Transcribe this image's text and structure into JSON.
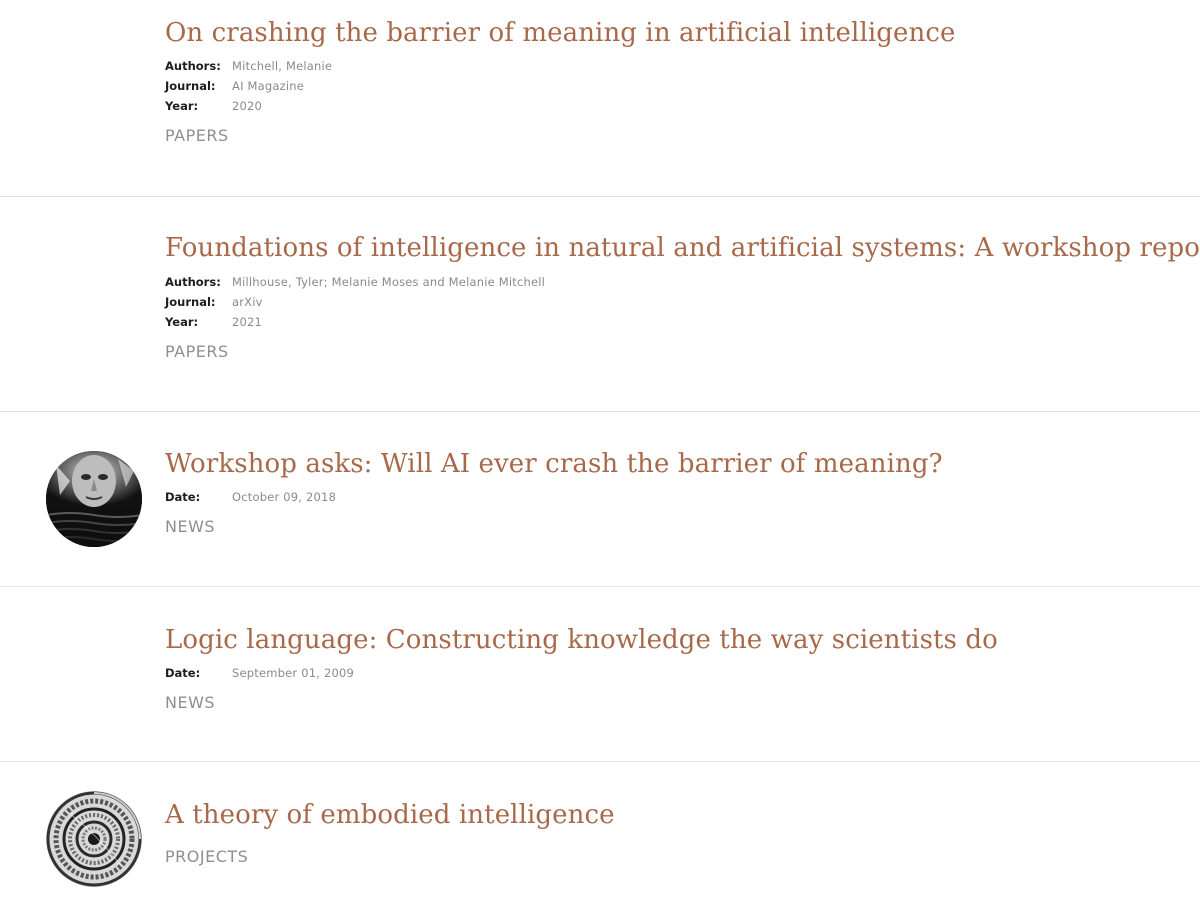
{
  "items": [
    {
      "title": "On crashing the barrier of meaning in artificial intelligence",
      "meta": [
        {
          "key": "Authors:",
          "value": "Mitchell, Melanie"
        },
        {
          "key": "Journal:",
          "value": "AI Magazine"
        },
        {
          "key": "Year:",
          "value": "2020"
        }
      ],
      "category": "PAPERS"
    },
    {
      "title": "Foundations of intelligence in natural and artificial systems: A workshop report",
      "meta": [
        {
          "key": "Authors:",
          "value": "Millhouse, Tyler; Melanie Moses and Melanie Mitchell"
        },
        {
          "key": "Journal:",
          "value": "arXiv"
        },
        {
          "key": "Year:",
          "value": "2021"
        }
      ],
      "category": "PAPERS"
    },
    {
      "title": "Workshop asks: Will AI ever crash the barrier of meaning?",
      "meta": [
        {
          "key": "Date:",
          "value": "October 09, 2018"
        }
      ],
      "category": "NEWS",
      "thumbnail": "face-reflection-thumbnail"
    },
    {
      "title": "Logic language: Constructing knowledge the way scientists do",
      "meta": [
        {
          "key": "Date:",
          "value": "September 01, 2009"
        }
      ],
      "category": "NEWS"
    },
    {
      "title": "A theory of embodied intelligence",
      "meta": [],
      "category": "PROJECTS",
      "thumbnail": "spiral-staircase-thumbnail"
    }
  ],
  "colors": {
    "title": "#a8694a",
    "category": "#8f8f8f",
    "meta_value": "#8a8a8a",
    "meta_key": "#1d1d1d",
    "divider": "#e6e3df"
  }
}
